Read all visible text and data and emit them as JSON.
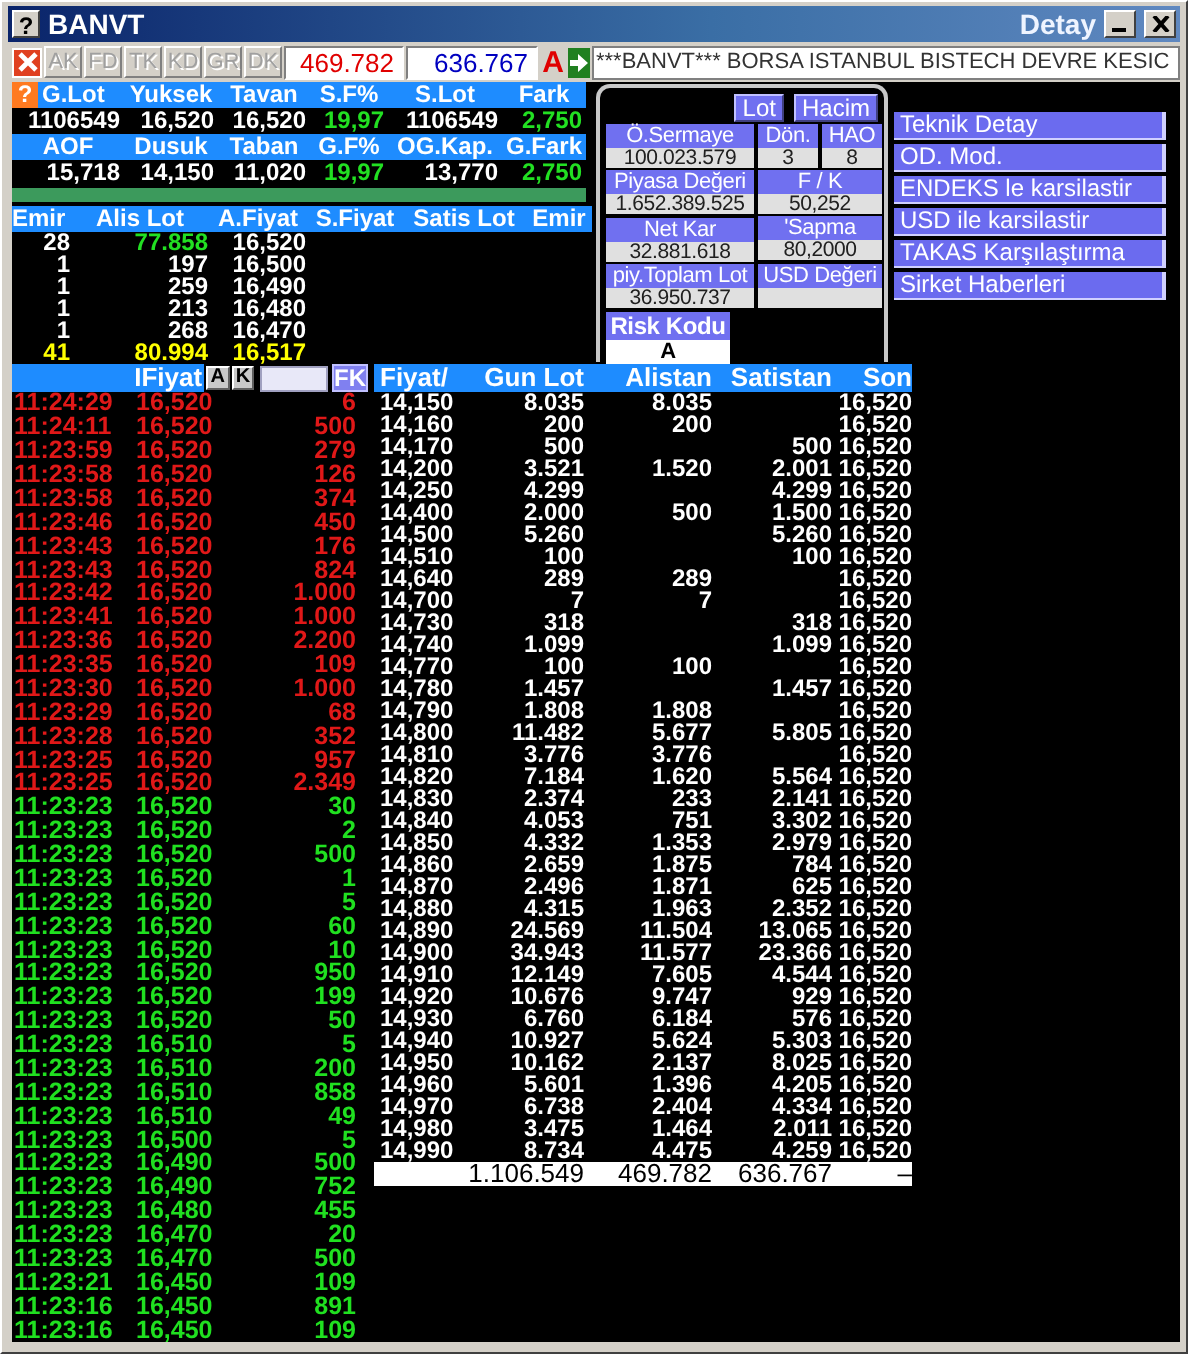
{
  "window": {
    "help_label": "?",
    "title": "BANVT",
    "subtitle": "Detay"
  },
  "toolbar": {
    "buttons": [
      {
        "label": "AK",
        "disabled": true
      },
      {
        "label": "FD",
        "disabled": true
      },
      {
        "label": "TK",
        "disabled": true
      },
      {
        "label": "KD",
        "disabled": true
      },
      {
        "label": "GR",
        "disabled": true
      },
      {
        "label": "DK",
        "disabled": true
      }
    ],
    "buy_total": "469.782",
    "sell_total": "636.767",
    "mode": "A",
    "ticker": "***BANVT*** BORSA ISTANBUL BISTECH DEVRE KESIC"
  },
  "summary": {
    "help_label": "?",
    "rows": [
      {
        "headers": [
          "G.Lot",
          "Yuksek",
          "Tavan",
          "S.F%",
          "S.Lot",
          "Fark"
        ],
        "values": [
          {
            "text": "1106549",
            "up": false
          },
          {
            "text": "16,520",
            "up": false
          },
          {
            "text": "16,520",
            "up": false
          },
          {
            "text": "19,97",
            "up": true
          },
          {
            "text": "1106549",
            "up": false
          },
          {
            "text": "2,750",
            "up": true
          }
        ]
      },
      {
        "headers": [
          "AOF",
          "Dusuk",
          "Taban",
          "G.F%",
          "OG.Kap.",
          "G.Fark"
        ],
        "values": [
          {
            "text": "15,718",
            "up": false
          },
          {
            "text": "14,150",
            "up": false
          },
          {
            "text": "11,020",
            "up": false
          },
          {
            "text": "19,97",
            "up": true
          },
          {
            "text": "13,770",
            "up": false
          },
          {
            "text": "2,750",
            "up": true
          }
        ]
      }
    ]
  },
  "depth": {
    "columns": [
      "Emir",
      "Alis Lot",
      "A.Fiyat",
      "S.Fiyat",
      "Satis Lot",
      "Emir"
    ],
    "rows": [
      {
        "kind": "level",
        "orders": "28",
        "lot": "77.858",
        "price": "16,520",
        "best": true
      },
      {
        "kind": "level",
        "orders": "1",
        "lot": "197",
        "price": "16,500",
        "best": false
      },
      {
        "kind": "level",
        "orders": "1",
        "lot": "259",
        "price": "16,490",
        "best": false
      },
      {
        "kind": "level",
        "orders": "1",
        "lot": "213",
        "price": "16,480",
        "best": false
      },
      {
        "kind": "level",
        "orders": "1",
        "lot": "268",
        "price": "16,470",
        "best": false
      },
      {
        "kind": "total",
        "orders": "41",
        "lot": "80.994",
        "price": "16,517",
        "best": false
      }
    ]
  },
  "info": {
    "tabs": [
      "Lot",
      "Hacim"
    ],
    "stats": [
      {
        "label": "Ö.Sermaye",
        "value": "100.023.579"
      },
      {
        "label": "Dön.",
        "value": "3"
      },
      {
        "label": "HAO",
        "value": "8"
      },
      {
        "label": "Piyasa Değeri",
        "value": "1.652.389.525"
      },
      {
        "label": "F / K",
        "value": "50,252"
      },
      {
        "label": "Net Kar",
        "value": "32.881.618"
      },
      {
        "label": "'Sapma",
        "value": "80,2000"
      },
      {
        "label": "piy.Toplam Lot",
        "value": "36.950.737"
      },
      {
        "label": "USD Değeri"
      }
    ],
    "risk": {
      "label": "Risk Kodu",
      "value": "A"
    },
    "links": [
      "Teknik Detay",
      "OD. Mod.",
      "ENDEKS le karsilastir",
      "USD ile karsilastir",
      "TAKAS Karşılaştırma",
      "Sirket Haberleri"
    ]
  },
  "trades": {
    "price_label": "IFiyat",
    "filter_buttons": [
      "A",
      "K"
    ],
    "fk_label": "FK",
    "rows": [
      {
        "time": "11:24:29",
        "price": "16,520",
        "lot": "6",
        "kind": "sell"
      },
      {
        "time": "11:24:11",
        "price": "16,520",
        "lot": "500",
        "kind": "sell"
      },
      {
        "time": "11:23:59",
        "price": "16,520",
        "lot": "279",
        "kind": "sell"
      },
      {
        "time": "11:23:58",
        "price": "16,520",
        "lot": "126",
        "kind": "sell"
      },
      {
        "time": "11:23:58",
        "price": "16,520",
        "lot": "374",
        "kind": "sell"
      },
      {
        "time": "11:23:46",
        "price": "16,520",
        "lot": "450",
        "kind": "sell"
      },
      {
        "time": "11:23:43",
        "price": "16,520",
        "lot": "176",
        "kind": "sell"
      },
      {
        "time": "11:23:43",
        "price": "16,520",
        "lot": "824",
        "kind": "sell"
      },
      {
        "time": "11:23:42",
        "price": "16,520",
        "lot": "1.000",
        "kind": "sell"
      },
      {
        "time": "11:23:41",
        "price": "16,520",
        "lot": "1.000",
        "kind": "sell"
      },
      {
        "time": "11:23:36",
        "price": "16,520",
        "lot": "2.200",
        "kind": "sell"
      },
      {
        "time": "11:23:35",
        "price": "16,520",
        "lot": "109",
        "kind": "sell"
      },
      {
        "time": "11:23:30",
        "price": "16,520",
        "lot": "1.000",
        "kind": "sell"
      },
      {
        "time": "11:23:29",
        "price": "16,520",
        "lot": "68",
        "kind": "sell"
      },
      {
        "time": "11:23:28",
        "price": "16,520",
        "lot": "352",
        "kind": "sell"
      },
      {
        "time": "11:23:25",
        "price": "16,520",
        "lot": "957",
        "kind": "sell"
      },
      {
        "time": "11:23:25",
        "price": "16,520",
        "lot": "2.349",
        "kind": "sell"
      },
      {
        "time": "11:23:23",
        "price": "16,520",
        "lot": "30",
        "kind": "buy"
      },
      {
        "time": "11:23:23",
        "price": "16,520",
        "lot": "2",
        "kind": "buy"
      },
      {
        "time": "11:23:23",
        "price": "16,520",
        "lot": "500",
        "kind": "buy"
      },
      {
        "time": "11:23:23",
        "price": "16,520",
        "lot": "1",
        "kind": "buy"
      },
      {
        "time": "11:23:23",
        "price": "16,520",
        "lot": "5",
        "kind": "buy"
      },
      {
        "time": "11:23:23",
        "price": "16,520",
        "lot": "60",
        "kind": "buy"
      },
      {
        "time": "11:23:23",
        "price": "16,520",
        "lot": "10",
        "kind": "buy"
      },
      {
        "time": "11:23:23",
        "price": "16,520",
        "lot": "950",
        "kind": "buy"
      },
      {
        "time": "11:23:23",
        "price": "16,520",
        "lot": "199",
        "kind": "buy"
      },
      {
        "time": "11:23:23",
        "price": "16,520",
        "lot": "50",
        "kind": "buy"
      },
      {
        "time": "11:23:23",
        "price": "16,510",
        "lot": "5",
        "kind": "buy"
      },
      {
        "time": "11:23:23",
        "price": "16,510",
        "lot": "200",
        "kind": "buy"
      },
      {
        "time": "11:23:23",
        "price": "16,510",
        "lot": "858",
        "kind": "buy"
      },
      {
        "time": "11:23:23",
        "price": "16,510",
        "lot": "49",
        "kind": "buy"
      },
      {
        "time": "11:23:23",
        "price": "16,500",
        "lot": "5",
        "kind": "buy"
      },
      {
        "time": "11:23:23",
        "price": "16,490",
        "lot": "500",
        "kind": "buy"
      },
      {
        "time": "11:23:23",
        "price": "16,490",
        "lot": "752",
        "kind": "buy"
      },
      {
        "time": "11:23:23",
        "price": "16,480",
        "lot": "455",
        "kind": "buy"
      },
      {
        "time": "11:23:23",
        "price": "16,470",
        "lot": "20",
        "kind": "buy"
      },
      {
        "time": "11:23:23",
        "price": "16,470",
        "lot": "500",
        "kind": "buy"
      },
      {
        "time": "11:23:21",
        "price": "16,450",
        "lot": "109",
        "kind": "buy"
      },
      {
        "time": "11:23:16",
        "price": "16,450",
        "lot": "891",
        "kind": "buy"
      },
      {
        "time": "11:23:16",
        "price": "16,450",
        "lot": "109",
        "kind": "buy"
      }
    ]
  },
  "prices": {
    "columns": [
      "Fiyat/",
      "Gun Lot",
      "Alistan",
      "Satistan",
      "Son"
    ],
    "rows": [
      {
        "price": "14,150",
        "volume": "8.035",
        "bid": "8.035",
        "last": "16,520"
      },
      {
        "price": "14,160",
        "volume": "200",
        "bid": "200",
        "last": "16,520"
      },
      {
        "price": "14,170",
        "volume": "500",
        "ask": "500",
        "last": "16,520"
      },
      {
        "price": "14,200",
        "volume": "3.521",
        "bid": "1.520",
        "ask": "2.001",
        "last": "16,520"
      },
      {
        "price": "14,250",
        "volume": "4.299",
        "ask": "4.299",
        "last": "16,520"
      },
      {
        "price": "14,400",
        "volume": "2.000",
        "bid": "500",
        "ask": "1.500",
        "last": "16,520"
      },
      {
        "price": "14,500",
        "volume": "5.260",
        "ask": "5.260",
        "last": "16,520"
      },
      {
        "price": "14,510",
        "volume": "100",
        "ask": "100",
        "last": "16,520"
      },
      {
        "price": "14,640",
        "volume": "289",
        "bid": "289",
        "last": "16,520"
      },
      {
        "price": "14,700",
        "volume": "7",
        "bid": "7",
        "last": "16,520"
      },
      {
        "price": "14,730",
        "volume": "318",
        "ask": "318",
        "last": "16,520"
      },
      {
        "price": "14,740",
        "volume": "1.099",
        "ask": "1.099",
        "last": "16,520"
      },
      {
        "price": "14,770",
        "volume": "100",
        "bid": "100",
        "last": "16,520"
      },
      {
        "price": "14,780",
        "volume": "1.457",
        "ask": "1.457",
        "last": "16,520"
      },
      {
        "price": "14,790",
        "volume": "1.808",
        "bid": "1.808",
        "last": "16,520"
      },
      {
        "price": "14,800",
        "volume": "11.482",
        "bid": "5.677",
        "ask": "5.805",
        "last": "16,520"
      },
      {
        "price": "14,810",
        "volume": "3.776",
        "bid": "3.776",
        "last": "16,520"
      },
      {
        "price": "14,820",
        "volume": "7.184",
        "bid": "1.620",
        "ask": "5.564",
        "last": "16,520"
      },
      {
        "price": "14,830",
        "volume": "2.374",
        "bid": "233",
        "ask": "2.141",
        "last": "16,520"
      },
      {
        "price": "14,840",
        "volume": "4.053",
        "bid": "751",
        "ask": "3.302",
        "last": "16,520"
      },
      {
        "price": "14,850",
        "volume": "4.332",
        "bid": "1.353",
        "ask": "2.979",
        "last": "16,520"
      },
      {
        "price": "14,860",
        "volume": "2.659",
        "bid": "1.875",
        "ask": "784",
        "last": "16,520"
      },
      {
        "price": "14,870",
        "volume": "2.496",
        "bid": "1.871",
        "ask": "625",
        "last": "16,520"
      },
      {
        "price": "14,880",
        "volume": "4.315",
        "bid": "1.963",
        "ask": "2.352",
        "last": "16,520"
      },
      {
        "price": "14,890",
        "volume": "24.569",
        "bid": "11.504",
        "ask": "13.065",
        "last": "16,520"
      },
      {
        "price": "14,900",
        "volume": "34.943",
        "bid": "11.577",
        "ask": "23.366",
        "last": "16,520"
      },
      {
        "price": "14,910",
        "volume": "12.149",
        "bid": "7.605",
        "ask": "4.544",
        "last": "16,520"
      },
      {
        "price": "14,920",
        "volume": "10.676",
        "bid": "9.747",
        "ask": "929",
        "last": "16,520"
      },
      {
        "price": "14,930",
        "volume": "6.760",
        "bid": "6.184",
        "ask": "576",
        "last": "16,520"
      },
      {
        "price": "14,940",
        "volume": "10.927",
        "bid": "5.624",
        "ask": "5.303",
        "last": "16,520"
      },
      {
        "price": "14,950",
        "volume": "10.162",
        "bid": "2.137",
        "ask": "8.025",
        "last": "16,520"
      },
      {
        "price": "14,960",
        "volume": "5.601",
        "bid": "1.396",
        "ask": "4.205",
        "last": "16,520"
      },
      {
        "price": "14,970",
        "volume": "6.738",
        "bid": "2.404",
        "ask": "4.334",
        "last": "16,520"
      },
      {
        "price": "14,980",
        "volume": "3.475",
        "bid": "1.464",
        "ask": "2.011",
        "last": "16,520"
      },
      {
        "price": "14,990",
        "volume": "8.734",
        "bid": "4.475",
        "ask": "4.259",
        "last": "16,520"
      }
    ],
    "totals": {
      "volume": "1.106.549",
      "bid": "469.782",
      "ask": "636.767",
      "last": "–"
    }
  }
}
